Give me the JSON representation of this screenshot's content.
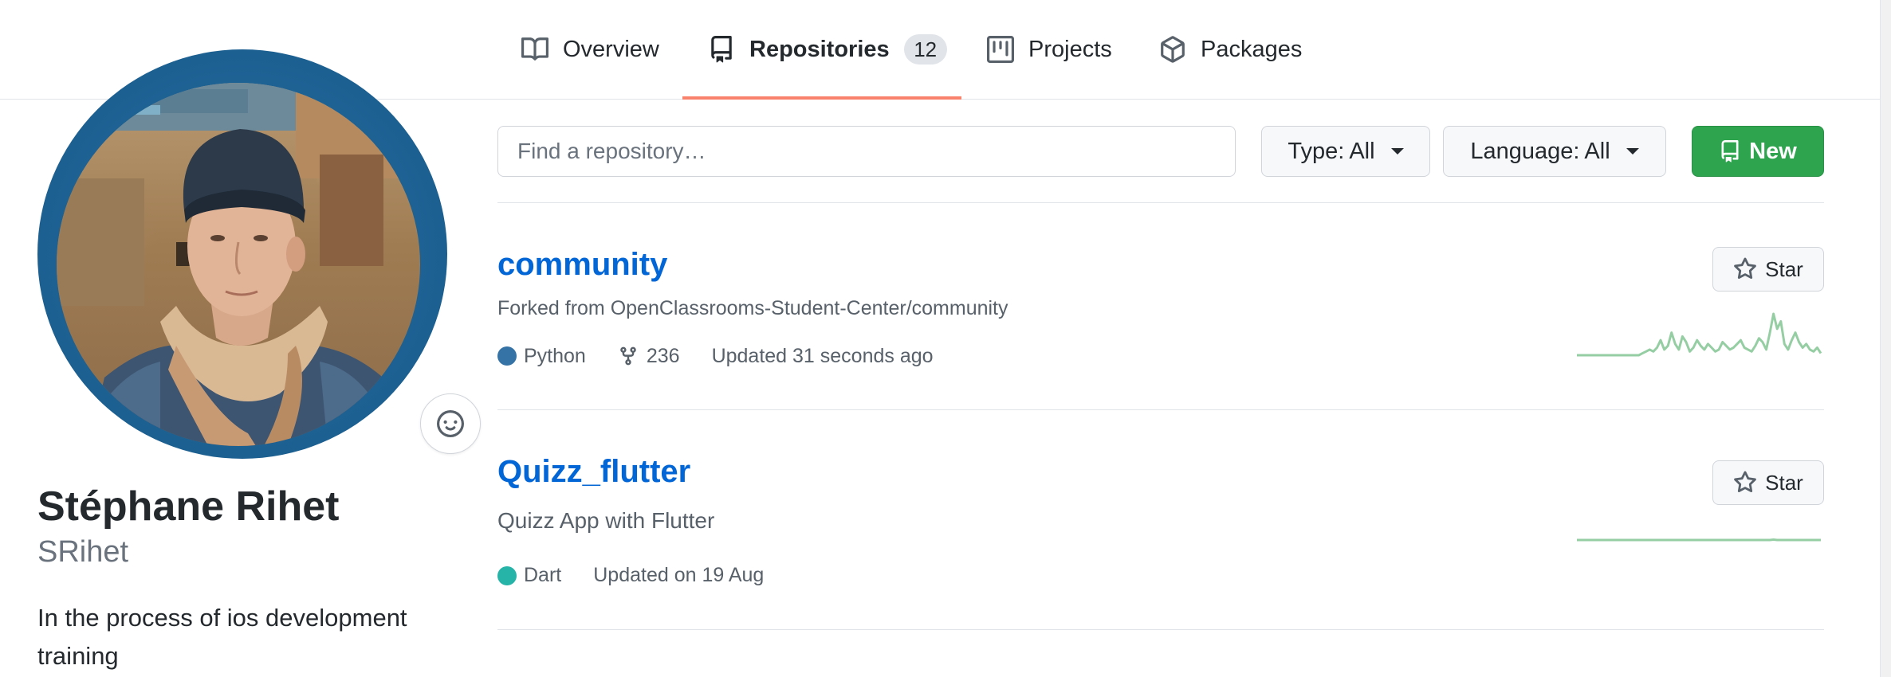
{
  "tabs": [
    {
      "label": "Overview",
      "icon": "book-icon"
    },
    {
      "label": "Repositories",
      "icon": "repo-icon",
      "count": "12",
      "selected": true
    },
    {
      "label": "Projects",
      "icon": "project-icon"
    },
    {
      "label": "Packages",
      "icon": "package-icon"
    }
  ],
  "profile": {
    "full_name": "Stéphane Rihet",
    "username": "SRihet",
    "bio": "In the process of ios development training",
    "status_icon": "smiley-icon"
  },
  "filters": {
    "search_placeholder": "Find a repository…",
    "type_label": "Type:",
    "type_value": "All",
    "language_label": "Language:",
    "language_value": "All",
    "new_label": "New"
  },
  "repos": [
    {
      "name": "community",
      "description": "Forked from OpenClassrooms-Student-Center/community",
      "language": "Python",
      "language_color": "#3572A5",
      "forks": "236",
      "updated": "Updated 31 seconds ago",
      "star_label": "Star",
      "activity": [
        0,
        0,
        0,
        0,
        0,
        0,
        0,
        0,
        0,
        0,
        0,
        0,
        0,
        0,
        0,
        0,
        0,
        0,
        1,
        2,
        3,
        2,
        4,
        8,
        3,
        5,
        12,
        6,
        3,
        10,
        7,
        2,
        4,
        8,
        5,
        3,
        6,
        4,
        2,
        3,
        7,
        5,
        3,
        4,
        6,
        8,
        4,
        3,
        2,
        5,
        9,
        7,
        3,
        12,
        22,
        14,
        18,
        6,
        3,
        8,
        12,
        7,
        4,
        6,
        3,
        2,
        4,
        1
      ],
      "activity_color": "#40a55a"
    },
    {
      "name": "Quizz_flutter",
      "description": "Quizz App with Flutter",
      "language": "Dart",
      "language_color": "#26b3a8",
      "updated": "Updated on 19 Aug",
      "star_label": "Star",
      "activity": [
        0,
        0,
        0,
        0,
        0,
        0,
        0,
        0,
        0,
        0,
        0,
        0,
        0,
        0,
        0,
        0,
        0,
        0,
        0,
        0,
        0,
        0,
        0,
        0,
        0,
        0,
        0,
        0,
        0,
        0,
        0,
        0,
        0,
        0,
        0,
        0,
        0,
        0,
        0,
        0,
        0,
        0,
        0,
        0,
        0,
        0,
        0,
        0,
        0,
        0,
        0,
        0,
        0,
        0,
        0.2,
        0,
        0,
        0,
        0,
        0,
        0,
        0,
        0,
        0,
        0,
        0,
        0,
        0
      ],
      "activity_color": "#40a55a"
    }
  ]
}
